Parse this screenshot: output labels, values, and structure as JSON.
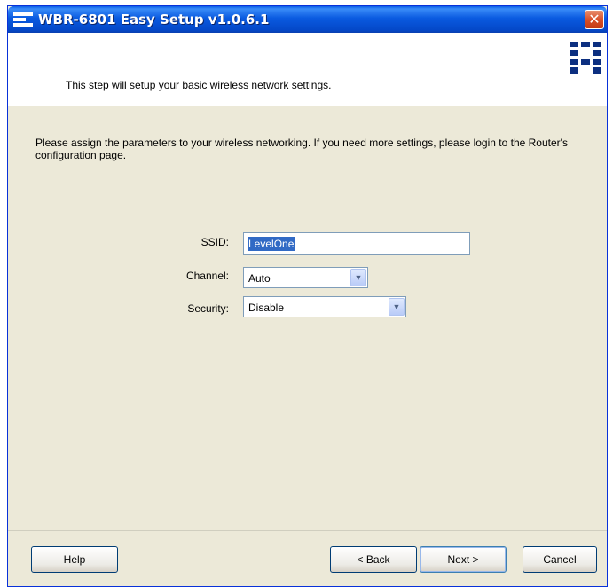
{
  "window": {
    "title": "WBR-6801 Easy Setup v1.0.6.1",
    "close_glyph": "✕"
  },
  "header": {
    "text": "This step will setup your basic wireless network settings."
  },
  "description": "Please assign the parameters to your wireless networking. If you need more settings, please login to the Router's configuration page.",
  "form": {
    "ssid_label": "SSID:",
    "ssid_value": "LevelOne",
    "channel_label": "Channel:",
    "channel_value": "Auto",
    "security_label": "Security:",
    "security_value": "Disable"
  },
  "buttons": {
    "help": "Help",
    "back": "< Back",
    "next": "Next >",
    "cancel": "Cancel"
  },
  "colors": {
    "titlebar": "#0A5AE0",
    "window_bg": "#ECE9D8",
    "selection": "#316AC5",
    "brand": "#0C2F80"
  },
  "icons": {
    "title_icon": "levelone-logo-icon",
    "brand": "levelone-logo-icon",
    "close": "close-icon",
    "dropdown": "chevron-down-icon"
  }
}
